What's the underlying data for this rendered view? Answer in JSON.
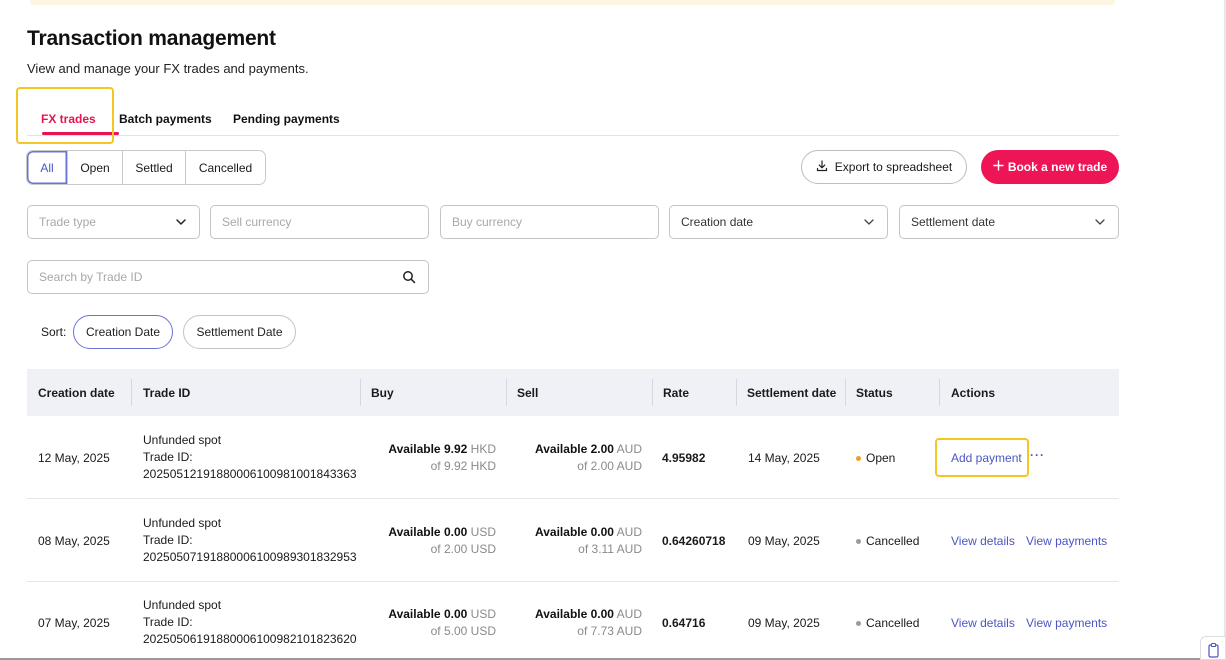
{
  "page": {
    "title": "Transaction management",
    "subtitle": "View and manage your FX trades and payments."
  },
  "tabs": [
    {
      "label": "FX trades",
      "active": true
    },
    {
      "label": "Batch payments",
      "active": false
    },
    {
      "label": "Pending payments",
      "active": false
    }
  ],
  "status_filter": {
    "options": [
      "All",
      "Open",
      "Settled",
      "Cancelled"
    ],
    "selected": "All"
  },
  "actions": {
    "export_label": "Export to spreadsheet",
    "book_label": "Book a new trade"
  },
  "filters": {
    "trade_type_placeholder": "Trade type",
    "sell_currency_placeholder": "Sell currency",
    "buy_currency_placeholder": "Buy currency",
    "creation_date_label": "Creation date",
    "settlement_date_label": "Settlement date",
    "search_placeholder": "Search by Trade ID"
  },
  "sort": {
    "label": "Sort:",
    "options": [
      "Creation Date",
      "Settlement Date"
    ],
    "selected": "Creation Date"
  },
  "table": {
    "headers": [
      "Creation date",
      "Trade ID",
      "Buy",
      "Sell",
      "Rate",
      "Settlement date",
      "Status",
      "Actions"
    ],
    "rows": [
      {
        "creation_date": "12 May, 2025",
        "trade_type": "Unfunded spot",
        "trade_id_label": "Trade ID:",
        "trade_id": "20250512191880006100981001843363",
        "buy_available_label": "Available",
        "buy_available": "9.92",
        "buy_currency": "HKD",
        "buy_of": "of 9.92 HKD",
        "sell_available_label": "Available",
        "sell_available": "2.00",
        "sell_currency": "AUD",
        "sell_of": "of 2.00 AUD",
        "rate": "4.95982",
        "settlement_date": "14 May, 2025",
        "status": "Open",
        "status_color": "#f0a21e",
        "action_1": "Add payment",
        "action_2": "···"
      },
      {
        "creation_date": "08 May, 2025",
        "trade_type": "Unfunded spot",
        "trade_id_label": "Trade ID:",
        "trade_id": "20250507191880006100989301832953",
        "buy_available_label": "Available",
        "buy_available": "0.00",
        "buy_currency": "USD",
        "buy_of": "of 2.00 USD",
        "sell_available_label": "Available",
        "sell_available": "0.00",
        "sell_currency": "AUD",
        "sell_of": "of 3.11 AUD",
        "rate": "0.64260718",
        "settlement_date": "09 May, 2025",
        "status": "Cancelled",
        "status_color": "#9a9a9a",
        "action_1": "View details",
        "action_2": "View payments"
      },
      {
        "creation_date": "07 May, 2025",
        "trade_type": "Unfunded spot",
        "trade_id_label": "Trade ID:",
        "trade_id": "20250506191880006100982101823620",
        "buy_available_label": "Available",
        "buy_available": "0.00",
        "buy_currency": "USD",
        "buy_of": "of 5.00 USD",
        "sell_available_label": "Available",
        "sell_available": "0.00",
        "sell_currency": "AUD",
        "sell_of": "of 7.73 AUD",
        "rate": "0.64716",
        "settlement_date": "09 May, 2025",
        "status": "Cancelled",
        "status_color": "#9a9a9a",
        "action_1": "View details",
        "action_2": "View payments"
      }
    ]
  },
  "colors": {
    "accent": "#ee1556",
    "link": "#4b55c4",
    "highlight": "#f4c623"
  },
  "icons": {
    "export": "download-icon",
    "book": "plus-icon",
    "dropdown": "chevron-down-icon",
    "search": "search-icon",
    "corner": "clipboard-icon"
  }
}
